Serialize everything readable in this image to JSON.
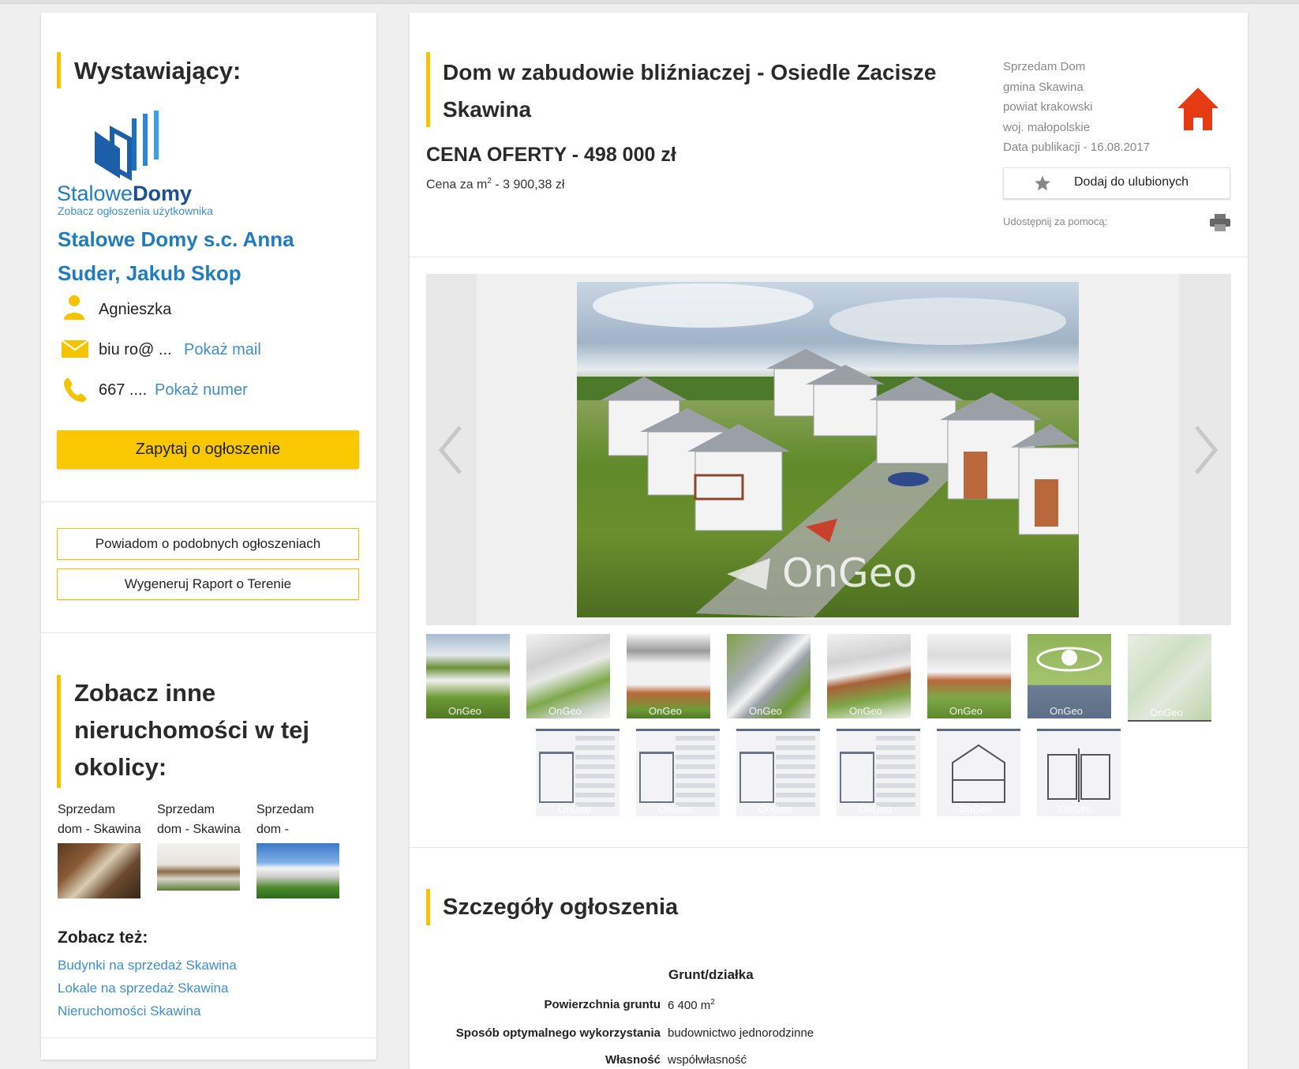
{
  "seller": {
    "heading": "Wystawiający:",
    "logo_text_light": "Stalowe",
    "logo_text_bold": "Domy",
    "see_listings": "Zobacz ogłoszenia użytkownika",
    "company_line1": "Stalowe Domy s.c. Anna",
    "company_line2": "Suder, Jakub Skop",
    "contact_name": "Agnieszka",
    "email_masked": "biu ro@ ...",
    "show_mail": "Pokaż mail",
    "phone_masked": "667 ....",
    "show_phone": "Pokaż numer",
    "ask_button": "Zapytaj o ogłoszenie",
    "notify_button": "Powiadom o podobnych ogłoszeniach",
    "report_button": "Wygeneruj Raport o Terenie"
  },
  "nearby": {
    "heading_line1": "Zobacz inne",
    "heading_line2": "nieruchomości w tej",
    "heading_line3": "okolicy:",
    "items": [
      {
        "line1": "Sprzedam",
        "line2": "dom - Skawina"
      },
      {
        "line1": "Sprzedam",
        "line2": "dom - Skawina"
      },
      {
        "line1": "Sprzedam",
        "line2": "dom -"
      }
    ],
    "see_also": "Zobacz też:",
    "links": [
      "Budynki na sprzedaż Skawina",
      "Lokale na sprzedaż Skawina",
      "Nieruchomości Skawina"
    ]
  },
  "listing": {
    "title_line1": "Dom w zabudowie bliźniaczej - Osiedle Zacisze",
    "title_line2": "Skawina",
    "price": "CENA OFERTY - 498 000 zł",
    "price_m2_prefix": "Cena za m",
    "price_m2_sup": "2",
    "price_m2_value": " - 3 900,38 zł",
    "meta": [
      "Sprzedam Dom",
      "gmina Skawina",
      "powiat krakowski",
      "woj. małopolskie",
      "Data publikacji - 16.08.2017"
    ],
    "favorite_button": "Dodaj do ulubionych",
    "share_label": "Udostępnij za pomocą:",
    "watermark": "OnGeo"
  },
  "details": {
    "heading": "Szczegóły ogłoszenia",
    "section": "Grunt/działka",
    "rows": [
      {
        "label": "Powierzchnia gruntu",
        "value": "6 400 m",
        "sup": "2"
      },
      {
        "label": "Sposób optymalnego wykorzystania",
        "value": "budownictwo jednorodzinne",
        "sup": ""
      },
      {
        "label": "Własność",
        "value": "współwłasność",
        "sup": ""
      }
    ]
  },
  "colors": {
    "accent": "#f5c400",
    "link": "#1f7cbf",
    "home_icon": "#e63b12"
  }
}
